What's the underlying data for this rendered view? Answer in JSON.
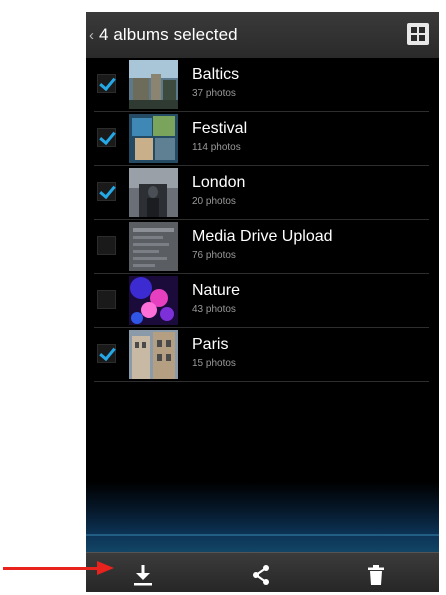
{
  "actionbar": {
    "back_glyph": "‹",
    "title": "4 albums selected",
    "grid_icon": "grid-view-icon"
  },
  "albums": [
    {
      "name": "Baltics",
      "count": "37 photos",
      "checked": true
    },
    {
      "name": "Festival",
      "count": "114 photos",
      "checked": true
    },
    {
      "name": "London",
      "count": "20 photos",
      "checked": true
    },
    {
      "name": "Media Drive Upload",
      "count": "76 photos",
      "checked": false
    },
    {
      "name": "Nature",
      "count": "43 photos",
      "checked": false
    },
    {
      "name": "Paris",
      "count": "15 photos",
      "checked": true
    }
  ],
  "bottombar": {
    "icons": [
      "download-icon",
      "share-icon",
      "trash-icon"
    ]
  },
  "colors": {
    "check_accent": "#24a8e6",
    "annotation_arrow": "#e8231d"
  }
}
